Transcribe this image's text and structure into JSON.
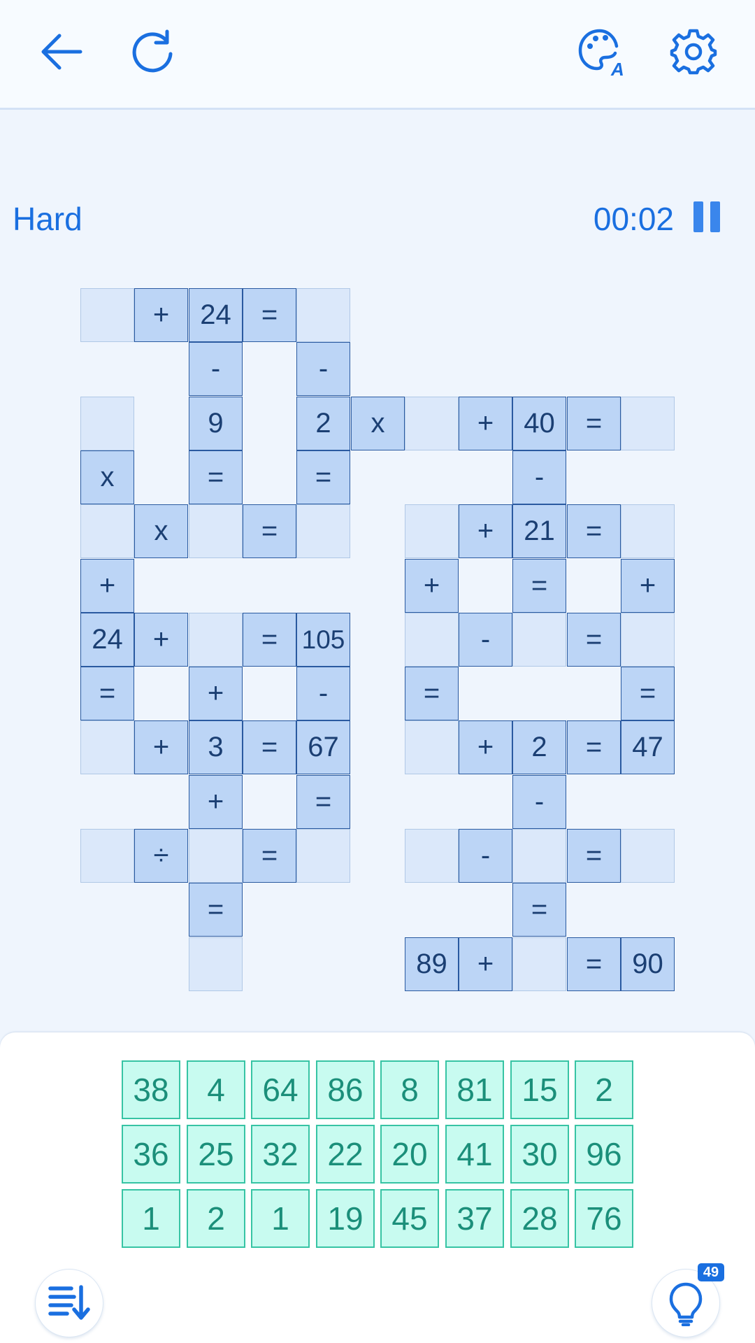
{
  "header": {
    "back_icon": "back-arrow-icon",
    "restart_icon": "restart-icon",
    "theme_icon": "palette-icon",
    "settings_icon": "gear-icon"
  },
  "status": {
    "difficulty": "Hard",
    "timer": "00:02"
  },
  "board": {
    "cells": [
      {
        "r": 0,
        "c": 0,
        "t": ""
      },
      {
        "r": 0,
        "c": 1,
        "t": "+"
      },
      {
        "r": 0,
        "c": 2,
        "t": "24"
      },
      {
        "r": 0,
        "c": 3,
        "t": "="
      },
      {
        "r": 0,
        "c": 4,
        "t": ""
      },
      {
        "r": 1,
        "c": 2,
        "t": "-"
      },
      {
        "r": 1,
        "c": 4,
        "t": "-"
      },
      {
        "r": 2,
        "c": 0,
        "t": ""
      },
      {
        "r": 2,
        "c": 2,
        "t": "9"
      },
      {
        "r": 2,
        "c": 4,
        "t": "2"
      },
      {
        "r": 2,
        "c": 5,
        "t": "x"
      },
      {
        "r": 2,
        "c": 6,
        "t": ""
      },
      {
        "r": 2,
        "c": 7,
        "t": "+"
      },
      {
        "r": 2,
        "c": 8,
        "t": "40"
      },
      {
        "r": 2,
        "c": 9,
        "t": "="
      },
      {
        "r": 2,
        "c": 10,
        "t": ""
      },
      {
        "r": 3,
        "c": 0,
        "t": "x"
      },
      {
        "r": 3,
        "c": 2,
        "t": "="
      },
      {
        "r": 3,
        "c": 4,
        "t": "="
      },
      {
        "r": 3,
        "c": 8,
        "t": "-"
      },
      {
        "r": 4,
        "c": 0,
        "t": ""
      },
      {
        "r": 4,
        "c": 1,
        "t": "x"
      },
      {
        "r": 4,
        "c": 2,
        "t": ""
      },
      {
        "r": 4,
        "c": 3,
        "t": "="
      },
      {
        "r": 4,
        "c": 4,
        "t": ""
      },
      {
        "r": 4,
        "c": 6,
        "t": ""
      },
      {
        "r": 4,
        "c": 7,
        "t": "+"
      },
      {
        "r": 4,
        "c": 8,
        "t": "21"
      },
      {
        "r": 4,
        "c": 9,
        "t": "="
      },
      {
        "r": 4,
        "c": 10,
        "t": ""
      },
      {
        "r": 5,
        "c": 0,
        "t": "+"
      },
      {
        "r": 5,
        "c": 6,
        "t": "+"
      },
      {
        "r": 5,
        "c": 8,
        "t": "="
      },
      {
        "r": 5,
        "c": 10,
        "t": "+"
      },
      {
        "r": 6,
        "c": 0,
        "t": "24"
      },
      {
        "r": 6,
        "c": 1,
        "t": "+"
      },
      {
        "r": 6,
        "c": 2,
        "t": ""
      },
      {
        "r": 6,
        "c": 3,
        "t": "="
      },
      {
        "r": 6,
        "c": 4,
        "t": "105"
      },
      {
        "r": 6,
        "c": 6,
        "t": ""
      },
      {
        "r": 6,
        "c": 7,
        "t": "-"
      },
      {
        "r": 6,
        "c": 8,
        "t": ""
      },
      {
        "r": 6,
        "c": 9,
        "t": "="
      },
      {
        "r": 6,
        "c": 10,
        "t": ""
      },
      {
        "r": 7,
        "c": 0,
        "t": "="
      },
      {
        "r": 7,
        "c": 2,
        "t": "+"
      },
      {
        "r": 7,
        "c": 4,
        "t": "-"
      },
      {
        "r": 7,
        "c": 6,
        "t": "="
      },
      {
        "r": 7,
        "c": 10,
        "t": "="
      },
      {
        "r": 8,
        "c": 0,
        "t": ""
      },
      {
        "r": 8,
        "c": 1,
        "t": "+"
      },
      {
        "r": 8,
        "c": 2,
        "t": "3"
      },
      {
        "r": 8,
        "c": 3,
        "t": "="
      },
      {
        "r": 8,
        "c": 4,
        "t": "67"
      },
      {
        "r": 8,
        "c": 6,
        "t": ""
      },
      {
        "r": 8,
        "c": 7,
        "t": "+"
      },
      {
        "r": 8,
        "c": 8,
        "t": "2"
      },
      {
        "r": 8,
        "c": 9,
        "t": "="
      },
      {
        "r": 8,
        "c": 10,
        "t": "47"
      },
      {
        "r": 9,
        "c": 2,
        "t": "+"
      },
      {
        "r": 9,
        "c": 4,
        "t": "="
      },
      {
        "r": 9,
        "c": 8,
        "t": "-"
      },
      {
        "r": 10,
        "c": 0,
        "t": ""
      },
      {
        "r": 10,
        "c": 1,
        "t": "÷"
      },
      {
        "r": 10,
        "c": 2,
        "t": ""
      },
      {
        "r": 10,
        "c": 3,
        "t": "="
      },
      {
        "r": 10,
        "c": 4,
        "t": ""
      },
      {
        "r": 10,
        "c": 6,
        "t": ""
      },
      {
        "r": 10,
        "c": 7,
        "t": "-"
      },
      {
        "r": 10,
        "c": 8,
        "t": ""
      },
      {
        "r": 10,
        "c": 9,
        "t": "="
      },
      {
        "r": 10,
        "c": 10,
        "t": ""
      },
      {
        "r": 11,
        "c": 2,
        "t": "="
      },
      {
        "r": 11,
        "c": 8,
        "t": "="
      },
      {
        "r": 12,
        "c": 2,
        "t": ""
      },
      {
        "r": 12,
        "c": 6,
        "t": "89"
      },
      {
        "r": 12,
        "c": 7,
        "t": "+"
      },
      {
        "r": 12,
        "c": 8,
        "t": ""
      },
      {
        "r": 12,
        "c": 9,
        "t": "="
      },
      {
        "r": 12,
        "c": 10,
        "t": "90"
      }
    ]
  },
  "number_bank": [
    [
      "38",
      "4",
      "64",
      "86",
      "8",
      "81",
      "15",
      "2"
    ],
    [
      "36",
      "25",
      "32",
      "22",
      "20",
      "41",
      "30",
      "96"
    ],
    [
      "1",
      "2",
      "1",
      "19",
      "45",
      "37",
      "28",
      "76"
    ]
  ],
  "footer": {
    "sort_icon": "sort-icon",
    "hint_icon": "lightbulb-icon",
    "hint_count": "49"
  }
}
